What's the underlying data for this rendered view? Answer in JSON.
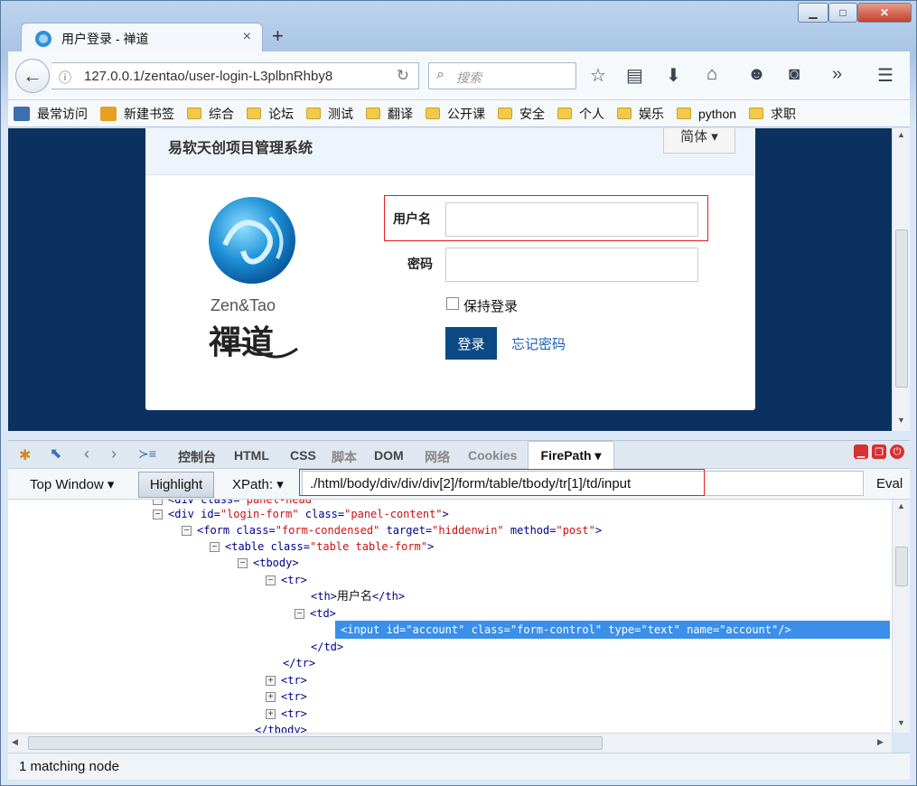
{
  "window": {
    "min": "▁",
    "max": "□",
    "close": "✕"
  },
  "tab": {
    "title": "用户登录 - 禅道",
    "close": "×",
    "new": "+"
  },
  "nav": {
    "url": "127.0.0.1/zentao/user-login-L3plbnRhby8",
    "search_placeholder": "搜索"
  },
  "bookmarks": [
    "最常访问",
    "新建书签",
    "综合",
    "论坛",
    "测试",
    "翻译",
    "公开课",
    "安全",
    "个人",
    "娱乐",
    "python",
    "求职"
  ],
  "page": {
    "title": "易软天创项目管理系统",
    "lang": "简体 ▾",
    "logo_text": "Zen&Tao",
    "logo_glyphs": "禪道",
    "username_label": "用户名",
    "password_label": "密码",
    "remember_label": "保持登录",
    "login_button": "登录",
    "forgot_link": "忘记密码"
  },
  "firebug": {
    "tabs": [
      "控制台",
      "HTML",
      "CSS",
      "脚本",
      "DOM",
      "网络",
      "Cookies"
    ],
    "active_tab": "FirePath ▾",
    "top_window": "Top Window ▾",
    "highlight": "Highlight",
    "xpath_label": "XPath:  ▾",
    "xpath_value": "./html/body/div/div/div[2]/form/table/tbody/tr[1]/td/input",
    "eval": "Eval",
    "status": "1 matching node"
  },
  "tree": {
    "r0": {
      "tag": "div",
      "attr": "class",
      "val": "panel-head"
    },
    "r1": {
      "id": "login-form",
      "cls": "panel-content"
    },
    "r2": {
      "cls": "form-condensed",
      "target": "hiddenwin",
      "method": "post"
    },
    "r3": {
      "cls": "table table-form"
    },
    "th_text": "用户名",
    "input": {
      "id": "account",
      "cls": "form-control",
      "type": "text",
      "name": "account"
    }
  }
}
